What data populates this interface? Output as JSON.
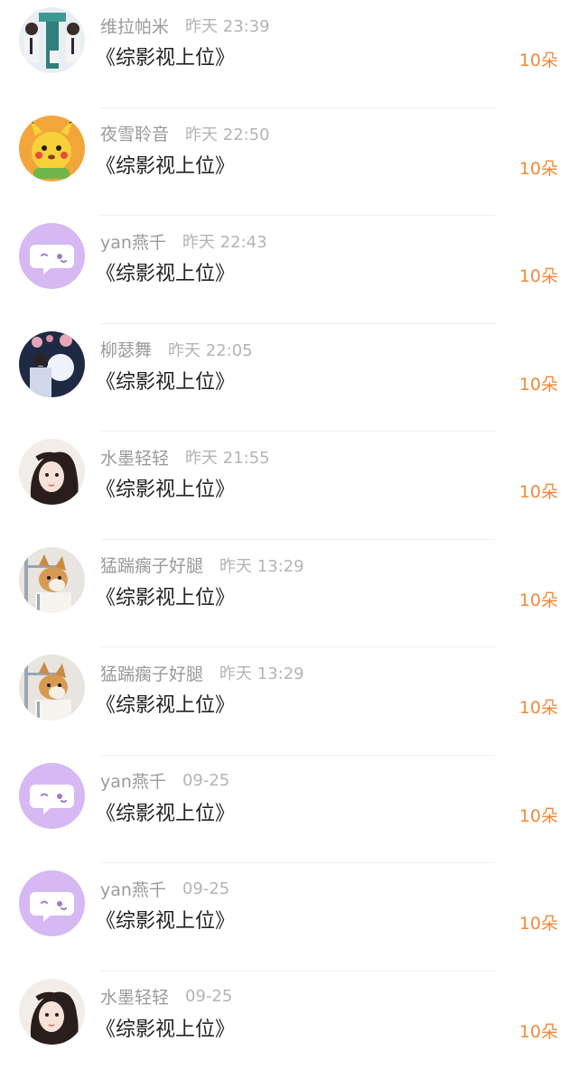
{
  "colors": {
    "count_orange": "#f08a3c",
    "default_avatar_purple": "#d6b8f2"
  },
  "entries": [
    {
      "name": "维拉帕米",
      "time": "昨天 23:39",
      "gift": "《综影视上位》",
      "count": "10朵",
      "avatar_icon": "boys-photo-avatar"
    },
    {
      "name": "夜雪聆音",
      "time": "昨天 22:50",
      "gift": "《综影视上位》",
      "count": "10朵",
      "avatar_icon": "pikachu-avatar"
    },
    {
      "name": "yan燕千",
      "time": "昨天 22:43",
      "gift": "《综影视上位》",
      "count": "10朵",
      "avatar_icon": "default-chat-avatar"
    },
    {
      "name": "柳瑟舞",
      "time": "昨天 22:05",
      "gift": "《综影视上位》",
      "count": "10朵",
      "avatar_icon": "girl-lantern-avatar"
    },
    {
      "name": "水墨轻轻",
      "time": "昨天 21:55",
      "gift": "《综影视上位》",
      "count": "10朵",
      "avatar_icon": "girl-portrait-avatar"
    },
    {
      "name": "猛踹瘸子好腿",
      "time": "昨天 13:29",
      "gift": "《综影视上位》",
      "count": "10朵",
      "avatar_icon": "shiba-dog-avatar"
    },
    {
      "name": "猛踹瘸子好腿",
      "time": "昨天 13:29",
      "gift": "《综影视上位》",
      "count": "10朵",
      "avatar_icon": "shiba-dog-avatar"
    },
    {
      "name": "yan燕千",
      "time": "09-25",
      "gift": "《综影视上位》",
      "count": "10朵",
      "avatar_icon": "default-chat-avatar"
    },
    {
      "name": "yan燕千",
      "time": "09-25",
      "gift": "《综影视上位》",
      "count": "10朵",
      "avatar_icon": "default-chat-avatar"
    },
    {
      "name": "水墨轻轻",
      "time": "09-25",
      "gift": "《综影视上位》",
      "count": "10朵",
      "avatar_icon": "girl-portrait-avatar"
    }
  ]
}
